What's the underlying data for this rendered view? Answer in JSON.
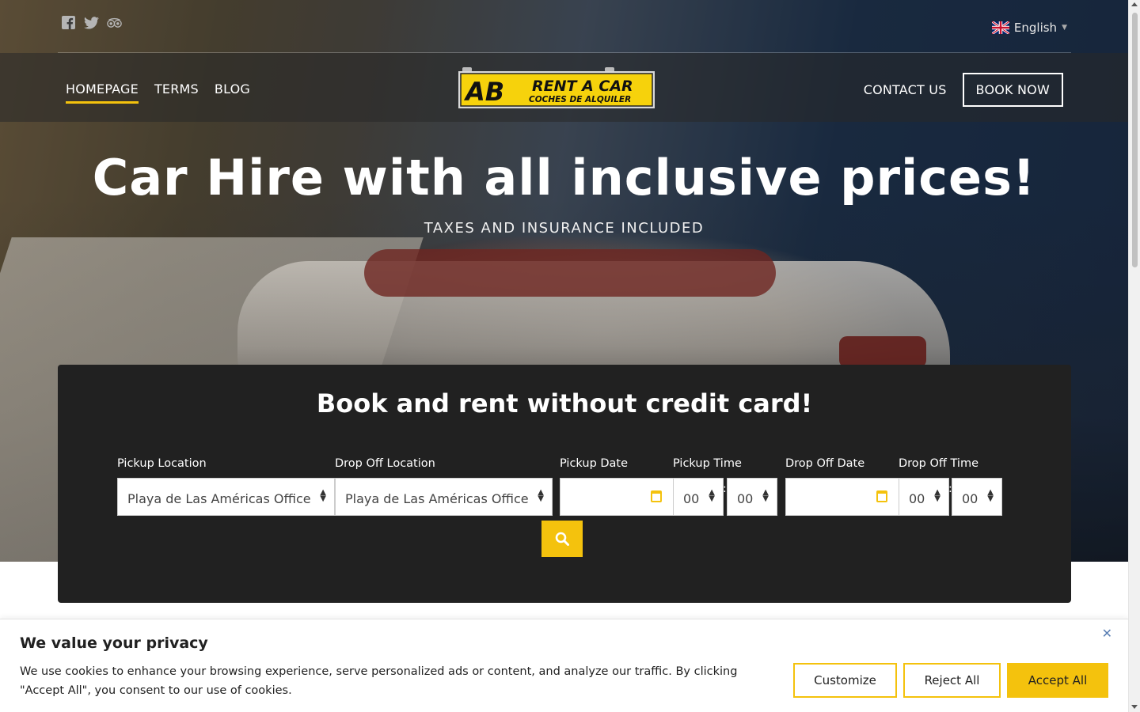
{
  "social": {
    "icons": [
      "facebook-icon",
      "twitter-icon",
      "tripadvisor-icon"
    ]
  },
  "language": {
    "label": "English",
    "flag": "uk-flag-icon"
  },
  "nav": {
    "left": [
      "HOMEPAGE",
      "TERMS",
      "BLOG"
    ],
    "active": "HOMEPAGE",
    "contact": "CONTACT US",
    "book_now": "BOOK NOW"
  },
  "logo": {
    "main": "RENT A CAR",
    "sub": "COCHES DE ALQUILER",
    "mark": "AB"
  },
  "hero": {
    "title": "Car Hire with all inclusive prices!",
    "subtitle": "TAXES AND INSURANCE INCLUDED"
  },
  "booking": {
    "title": "Book and rent without credit card!",
    "pickup_location_label": "Pickup Location",
    "pickup_location_value": "Playa de Las Américas Office",
    "dropoff_location_label": "Drop Off Location",
    "dropoff_location_value": "Playa de Las Américas Office",
    "pickup_date_label": "Pickup Date",
    "pickup_time_label": "Pickup Time",
    "pickup_hour": "00",
    "pickup_minute": "00",
    "dropoff_date_label": "Drop Off Date",
    "dropoff_time_label": "Drop Off Time",
    "dropoff_hour": "00",
    "dropoff_minute": "00",
    "time_separator": ":"
  },
  "cookie": {
    "title": "We value your privacy",
    "text": "We use cookies to enhance your browsing experience, serve personalized ads or content, and analyze our traffic. By clicking \"Accept All\", you consent to our use of cookies.",
    "customize": "Customize",
    "reject": "Reject All",
    "accept": "Accept All",
    "close": "✕"
  },
  "colors": {
    "accent": "#f4c20d",
    "panel": "#212121",
    "nav_overlay": "#282828"
  }
}
